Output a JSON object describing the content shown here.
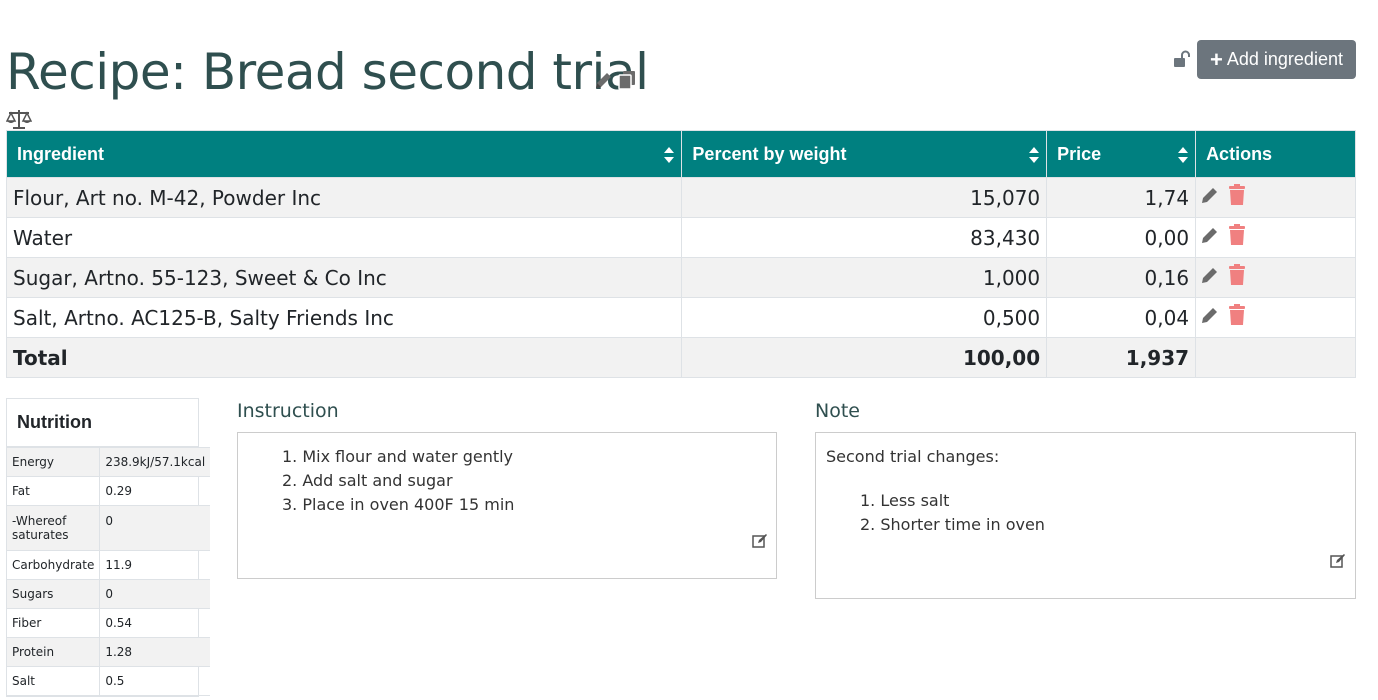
{
  "header": {
    "title": "Recipe: Bread second trial",
    "add_button_label": "Add ingredient",
    "icons": [
      "pencil-icon",
      "copy-icon",
      "scale-icon",
      "unlock-icon",
      "plus-icon"
    ]
  },
  "table": {
    "columns": [
      "Ingredient",
      "Percent by weight",
      "Price",
      "Actions"
    ],
    "rows": [
      {
        "ingredient": "Flour, Art no. M-42, Powder Inc",
        "percent": "15,070",
        "price": "1,74"
      },
      {
        "ingredient": "Water",
        "percent": "83,430",
        "price": "0,00"
      },
      {
        "ingredient": "Sugar, Artno. 55-123, Sweet & Co Inc",
        "percent": "1,000",
        "price": "0,16"
      },
      {
        "ingredient": "Salt, Artno. AC125-B, Salty Friends Inc",
        "percent": "0,500",
        "price": "0,04"
      }
    ],
    "total": {
      "label": "Total",
      "percent": "100,00",
      "price": "1,937"
    }
  },
  "nutrition": {
    "title": "Nutrition",
    "rows": [
      {
        "name": "Energy",
        "value": "238.9kJ/57.1kcal"
      },
      {
        "name": "Fat",
        "value": "0.29"
      },
      {
        "name": "-Whereof saturates",
        "value": "0"
      },
      {
        "name": "Carbohydrate",
        "value": "11.9"
      },
      {
        "name": "Sugars",
        "value": "0"
      },
      {
        "name": "Fiber",
        "value": "0.54"
      },
      {
        "name": "Protein",
        "value": "1.28"
      },
      {
        "name": "Salt",
        "value": "0.5"
      }
    ]
  },
  "instruction": {
    "title": "Instruction",
    "steps": [
      "1. Mix flour and water gently",
      "2. Add salt and sugar",
      "3. Place in oven 400F 15 min"
    ]
  },
  "note": {
    "title": "Note",
    "intro": "Second trial changes:",
    "items": [
      "1. Less salt",
      "2. Shorter time in oven"
    ]
  },
  "colors": {
    "header_bg": "#008080",
    "title_color": "#2f4f4f",
    "button_bg": "#6c757d",
    "delete_icon": "#f08080"
  }
}
